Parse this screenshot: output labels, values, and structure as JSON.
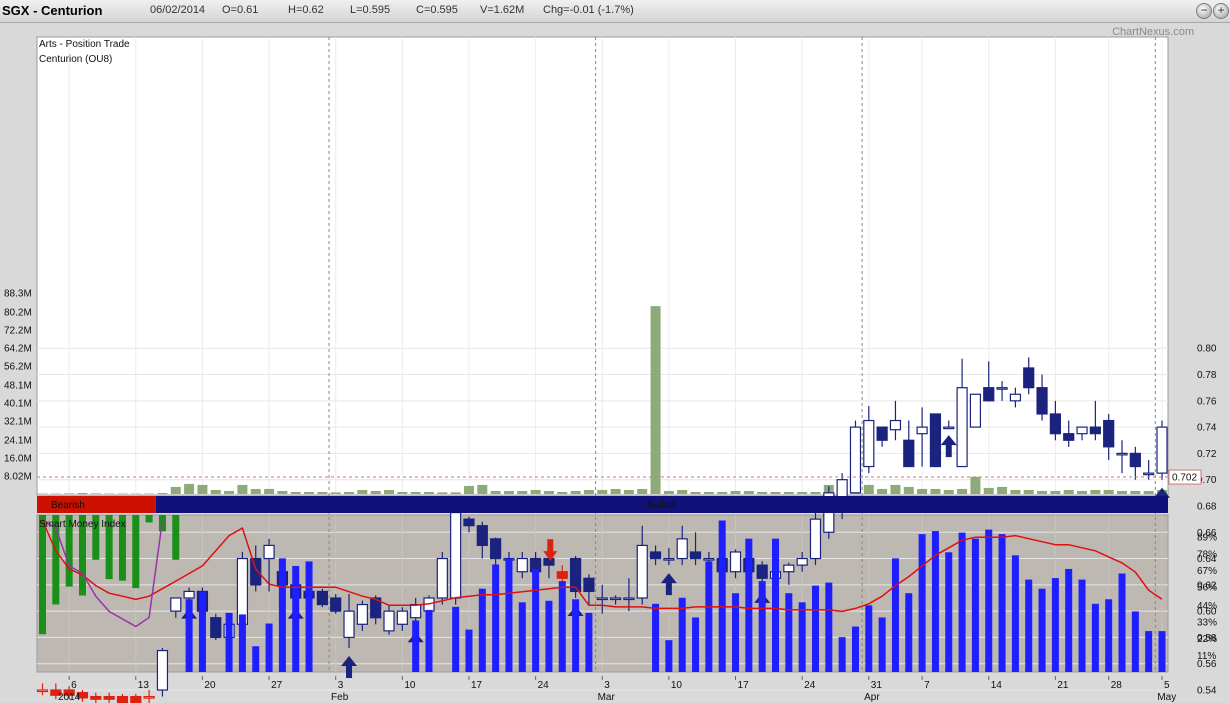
{
  "header": {
    "exchange": "SGX - Centurion",
    "date": "06/02/2014",
    "open": "O=0.61",
    "high": "H=0.62",
    "low": "L=0.595",
    "close": "C=0.595",
    "volume": "V=1.62M",
    "change": "Chg=-0.01 (-1.7%)",
    "brand": "ChartNexus.com",
    "btn_minus": "−",
    "btn_plus": "+"
  },
  "colors": {
    "up_candle": "#ffffff",
    "down_candle": "#1a237e",
    "signal_candle": "#dd2211",
    "volume_bar": "#8faa79",
    "bearish_band": "#cc1100",
    "bullish_band": "#10127a",
    "smi_bar": "#1e1eff",
    "smi_alt_bar": "#1a8f1a",
    "ma_line": "#dd1111",
    "smi_overlay_line": "#9933aa",
    "price_tag": "#cc0000"
  },
  "chart_data": {
    "type": "candlestick",
    "title": "Centurion (OU8)",
    "subtitle": "Arts - Position Trade",
    "x": [
      "2014-01-02",
      "2014-01-03",
      "2014-01-06",
      "2014-01-07",
      "2014-01-08",
      "2014-01-09",
      "2014-01-10",
      "2014-01-13",
      "2014-01-14",
      "2014-01-15",
      "2014-01-16",
      "2014-01-17",
      "2014-01-20",
      "2014-01-21",
      "2014-01-22",
      "2014-01-23",
      "2014-01-24",
      "2014-01-27",
      "2014-01-28",
      "2014-01-29",
      "2014-01-30",
      "2014-02-03",
      "2014-02-04",
      "2014-02-05",
      "2014-02-06",
      "2014-02-07",
      "2014-02-10",
      "2014-02-11",
      "2014-02-12",
      "2014-02-13",
      "2014-02-14",
      "2014-02-17",
      "2014-02-18",
      "2014-02-19",
      "2014-02-20",
      "2014-02-21",
      "2014-02-24",
      "2014-02-25",
      "2014-02-26",
      "2014-02-27",
      "2014-02-28",
      "2014-03-03",
      "2014-03-04",
      "2014-03-05",
      "2014-03-06",
      "2014-03-07",
      "2014-03-10",
      "2014-03-11",
      "2014-03-12",
      "2014-03-13",
      "2014-03-14",
      "2014-03-17",
      "2014-03-18",
      "2014-03-19",
      "2014-03-20",
      "2014-03-21",
      "2014-03-24",
      "2014-03-25",
      "2014-03-26",
      "2014-03-27",
      "2014-03-28",
      "2014-03-31",
      "2014-04-01",
      "2014-04-02",
      "2014-04-03",
      "2014-04-04",
      "2014-04-07",
      "2014-04-08",
      "2014-04-09",
      "2014-04-10",
      "2014-04-11",
      "2014-04-14",
      "2014-04-15",
      "2014-04-16",
      "2014-04-17",
      "2014-04-21",
      "2014-04-22",
      "2014-04-23",
      "2014-04-24",
      "2014-04-25",
      "2014-04-28",
      "2014-04-29",
      "2014-04-30",
      "2014-05-02",
      "2014-05-05"
    ],
    "open": [
      0.54,
      0.54,
      0.54,
      0.538,
      0.535,
      0.535,
      0.535,
      0.535,
      0.535,
      0.54,
      0.6,
      0.61,
      0.615,
      0.595,
      0.58,
      0.59,
      0.64,
      0.64,
      0.63,
      0.62,
      0.615,
      0.615,
      0.61,
      0.58,
      0.59,
      0.61,
      0.585,
      0.59,
      0.595,
      0.6,
      0.61,
      0.61,
      0.67,
      0.665,
      0.655,
      0.64,
      0.63,
      0.64,
      0.64,
      0.63,
      0.64,
      0.625,
      0.61,
      0.61,
      0.61,
      0.61,
      0.645,
      0.64,
      0.64,
      0.645,
      0.64,
      0.64,
      0.63,
      0.64,
      0.635,
      0.625,
      0.63,
      0.635,
      0.64,
      0.66,
      0.68,
      0.69,
      0.71,
      0.74,
      0.738,
      0.73,
      0.735,
      0.75,
      0.74,
      0.71,
      0.74,
      0.77,
      0.77,
      0.76,
      0.785,
      0.77,
      0.75,
      0.735,
      0.735,
      0.74,
      0.745,
      0.72,
      0.72,
      0.705,
      0.705
    ],
    "close": [
      0.54,
      0.536,
      0.536,
      0.534,
      0.533,
      0.533,
      0.53,
      0.53,
      0.535,
      0.57,
      0.61,
      0.615,
      0.6,
      0.58,
      0.59,
      0.64,
      0.62,
      0.65,
      0.62,
      0.61,
      0.61,
      0.605,
      0.6,
      0.6,
      0.605,
      0.595,
      0.6,
      0.6,
      0.605,
      0.61,
      0.64,
      0.675,
      0.665,
      0.65,
      0.64,
      0.64,
      0.64,
      0.63,
      0.635,
      0.625,
      0.615,
      0.615,
      0.61,
      0.61,
      0.61,
      0.65,
      0.64,
      0.64,
      0.655,
      0.64,
      0.64,
      0.63,
      0.645,
      0.63,
      0.625,
      0.63,
      0.635,
      0.64,
      0.67,
      0.69,
      0.7,
      0.74,
      0.745,
      0.73,
      0.745,
      0.71,
      0.74,
      0.71,
      0.74,
      0.77,
      0.765,
      0.76,
      0.77,
      0.765,
      0.77,
      0.75,
      0.735,
      0.73,
      0.74,
      0.735,
      0.725,
      0.72,
      0.71,
      0.705,
      0.74
    ],
    "high": [
      0.545,
      0.545,
      0.543,
      0.54,
      0.538,
      0.538,
      0.537,
      0.537,
      0.54,
      0.572,
      0.61,
      0.618,
      0.618,
      0.598,
      0.595,
      0.645,
      0.65,
      0.655,
      0.632,
      0.622,
      0.617,
      0.617,
      0.613,
      0.613,
      0.608,
      0.612,
      0.605,
      0.603,
      0.61,
      0.612,
      0.645,
      0.68,
      0.672,
      0.668,
      0.656,
      0.645,
      0.645,
      0.645,
      0.645,
      0.635,
      0.642,
      0.628,
      0.62,
      0.612,
      0.625,
      0.665,
      0.65,
      0.648,
      0.665,
      0.66,
      0.645,
      0.645,
      0.647,
      0.645,
      0.638,
      0.632,
      0.637,
      0.645,
      0.675,
      0.695,
      0.705,
      0.745,
      0.756,
      0.74,
      0.76,
      0.745,
      0.755,
      0.75,
      0.745,
      0.792,
      0.765,
      0.79,
      0.775,
      0.77,
      0.793,
      0.78,
      0.76,
      0.745,
      0.74,
      0.76,
      0.75,
      0.73,
      0.725,
      0.715,
      0.745
    ],
    "low": [
      0.536,
      0.533,
      0.533,
      0.531,
      0.53,
      0.53,
      0.528,
      0.528,
      0.522,
      0.535,
      0.595,
      0.608,
      0.598,
      0.578,
      0.575,
      0.588,
      0.615,
      0.615,
      0.618,
      0.608,
      0.605,
      0.603,
      0.598,
      0.572,
      0.585,
      0.59,
      0.582,
      0.585,
      0.59,
      0.598,
      0.605,
      0.605,
      0.66,
      0.64,
      0.63,
      0.625,
      0.625,
      0.62,
      0.625,
      0.615,
      0.61,
      0.605,
      0.598,
      0.605,
      0.6,
      0.605,
      0.635,
      0.635,
      0.635,
      0.635,
      0.63,
      0.62,
      0.625,
      0.625,
      0.62,
      0.615,
      0.62,
      0.63,
      0.635,
      0.655,
      0.67,
      0.69,
      0.705,
      0.725,
      0.73,
      0.71,
      0.71,
      0.71,
      0.74,
      0.71,
      0.74,
      0.76,
      0.76,
      0.755,
      0.765,
      0.745,
      0.73,
      0.725,
      0.73,
      0.73,
      0.715,
      0.705,
      0.7,
      0.7,
      0.7
    ],
    "signal_candles": [
      39
    ],
    "volume_m": [
      0.2,
      0.2,
      0.3,
      0.5,
      0.3,
      0.2,
      0.2,
      0.2,
      0.2,
      0.5,
      3.5,
      5.0,
      4.5,
      2.0,
      1.5,
      4.5,
      2.5,
      2.5,
      1.5,
      1.0,
      1.0,
      1.0,
      0.8,
      1.0,
      2.0,
      1.5,
      2.0,
      1.0,
      1.0,
      1.0,
      0.8,
      0.8,
      4.0,
      4.5,
      1.5,
      1.5,
      1.5,
      2.0,
      1.5,
      1.0,
      1.5,
      2.0,
      2.0,
      2.5,
      2.0,
      2.5,
      93.0,
      1.5,
      2.0,
      1.0,
      1.0,
      1.0,
      1.5,
      1.5,
      1.0,
      1.0,
      1.0,
      1.0,
      1.0,
      4.5,
      5.0,
      4.0,
      4.5,
      2.5,
      4.5,
      3.5,
      2.5,
      2.5,
      2.0,
      2.5,
      8.5,
      3.0,
      3.5,
      2.0,
      2.0,
      1.5,
      1.5,
      2.0,
      1.5,
      2.0,
      2.0,
      1.5,
      1.5,
      1.5,
      2.0
    ],
    "volume_ticks": [
      "8.02M",
      "16.0M",
      "24.1M",
      "32.1M",
      "40.1M",
      "48.1M",
      "56.2M",
      "64.2M",
      "72.2M",
      "80.2M",
      "88.3M"
    ],
    "y_ticks": [
      "0.52",
      "0.54",
      "0.56",
      "0.58",
      "0.60",
      "0.62",
      "0.64",
      "0.66",
      "0.68",
      "0.70",
      "0.72",
      "0.74",
      "0.76",
      "0.78",
      "0.80"
    ],
    "ylim": [
      0.5,
      0.81
    ],
    "last_price": "0.702",
    "up_arrows": [
      7,
      11,
      19,
      23,
      28,
      40,
      47,
      54,
      68,
      84
    ],
    "down_arrows": [
      39
    ],
    "sentiment": [
      {
        "label": "Bearish",
        "from": 0,
        "to": 8
      },
      {
        "label": "Bullish",
        "from": 9,
        "to": 84
      }
    ],
    "smi": {
      "title": "Smart Money Index",
      "ticks": [
        "11%",
        "22%",
        "33%",
        "44%",
        "56%",
        "67%",
        "78%",
        "89%"
      ],
      "bars": [
        -80,
        -60,
        -48,
        -54,
        -30,
        -43,
        -44,
        -49,
        -5,
        -11,
        -30,
        48,
        53,
        0,
        39,
        38,
        17,
        32,
        75,
        70,
        73,
        0,
        0,
        0,
        0,
        0,
        0,
        0,
        34,
        41,
        0,
        43,
        28,
        55,
        71,
        75,
        46,
        68,
        47,
        60,
        48,
        39,
        0,
        0,
        0,
        0,
        45,
        21,
        49,
        36,
        73,
        100,
        52,
        88,
        60,
        88,
        52,
        46,
        57,
        59,
        23,
        30,
        44,
        36,
        75,
        52,
        91,
        93,
        79,
        92,
        88,
        94,
        91,
        77,
        61,
        55,
        62,
        68,
        61,
        45,
        48,
        65,
        40,
        27,
        27
      ],
      "bar_types": [
        "g",
        "g",
        "g",
        "g",
        "g",
        "g",
        "g",
        "g",
        "g",
        "g",
        "b",
        "b",
        "b",
        "b",
        "b",
        "b",
        "b",
        "b",
        "b",
        "b",
        "b",
        "b",
        "b",
        "b",
        "b",
        "b",
        "b",
        "b",
        "b",
        "b",
        "b",
        "b",
        "b",
        "b",
        "b",
        "b",
        "b",
        "b",
        "b",
        "b",
        "b",
        "b",
        "b",
        "b",
        "b",
        "b",
        "b",
        "b",
        "b",
        "b",
        "b",
        "b",
        "b",
        "b",
        "b",
        "b",
        "b",
        "b",
        "b",
        "b",
        "b",
        "b",
        "b",
        "b",
        "b",
        "b",
        "b",
        "b",
        "b",
        "b",
        "b",
        "b",
        "b",
        "b",
        "b",
        "b",
        "b",
        "b",
        "b",
        "b",
        "b",
        "b",
        "b",
        "b",
        "b"
      ],
      "ma": [
        100,
        80,
        68,
        64,
        57,
        52,
        50,
        48,
        50,
        55,
        60,
        65,
        70,
        80,
        90,
        95,
        68,
        58,
        56,
        56,
        56,
        56,
        56,
        53,
        50,
        48,
        44,
        44,
        44,
        45,
        47,
        49,
        50,
        51,
        51,
        52,
        53,
        54,
        55,
        56,
        56,
        44,
        44,
        43,
        43,
        43,
        42,
        42,
        42,
        43,
        43,
        43,
        43,
        42,
        42,
        42,
        41,
        41,
        41,
        41,
        40,
        42,
        45,
        50,
        57,
        63,
        70,
        77,
        82,
        87,
        89,
        89,
        89,
        90,
        88,
        86,
        84,
        84,
        82,
        80,
        76,
        72,
        66,
        54,
        48
      ],
      "overlay_line": [
        110,
        95,
        70,
        65,
        50,
        40,
        35,
        30,
        36,
        115
      ]
    },
    "x_tick_labels": [
      "6",
      "13",
      "20",
      "27",
      "3",
      "10",
      "17",
      "24",
      "3",
      "10",
      "17",
      "24",
      "31",
      "7",
      "14",
      "21",
      "28",
      "5"
    ],
    "x_tick_index": [
      2,
      7,
      12,
      17,
      22,
      27,
      32,
      37,
      42,
      47,
      52,
      57,
      62,
      66,
      71,
      76,
      80,
      84
    ],
    "month_labels": [
      "2014",
      "Feb",
      "Mar",
      "Apr",
      "May"
    ],
    "month_index": [
      0,
      22,
      42,
      62,
      84
    ]
  }
}
